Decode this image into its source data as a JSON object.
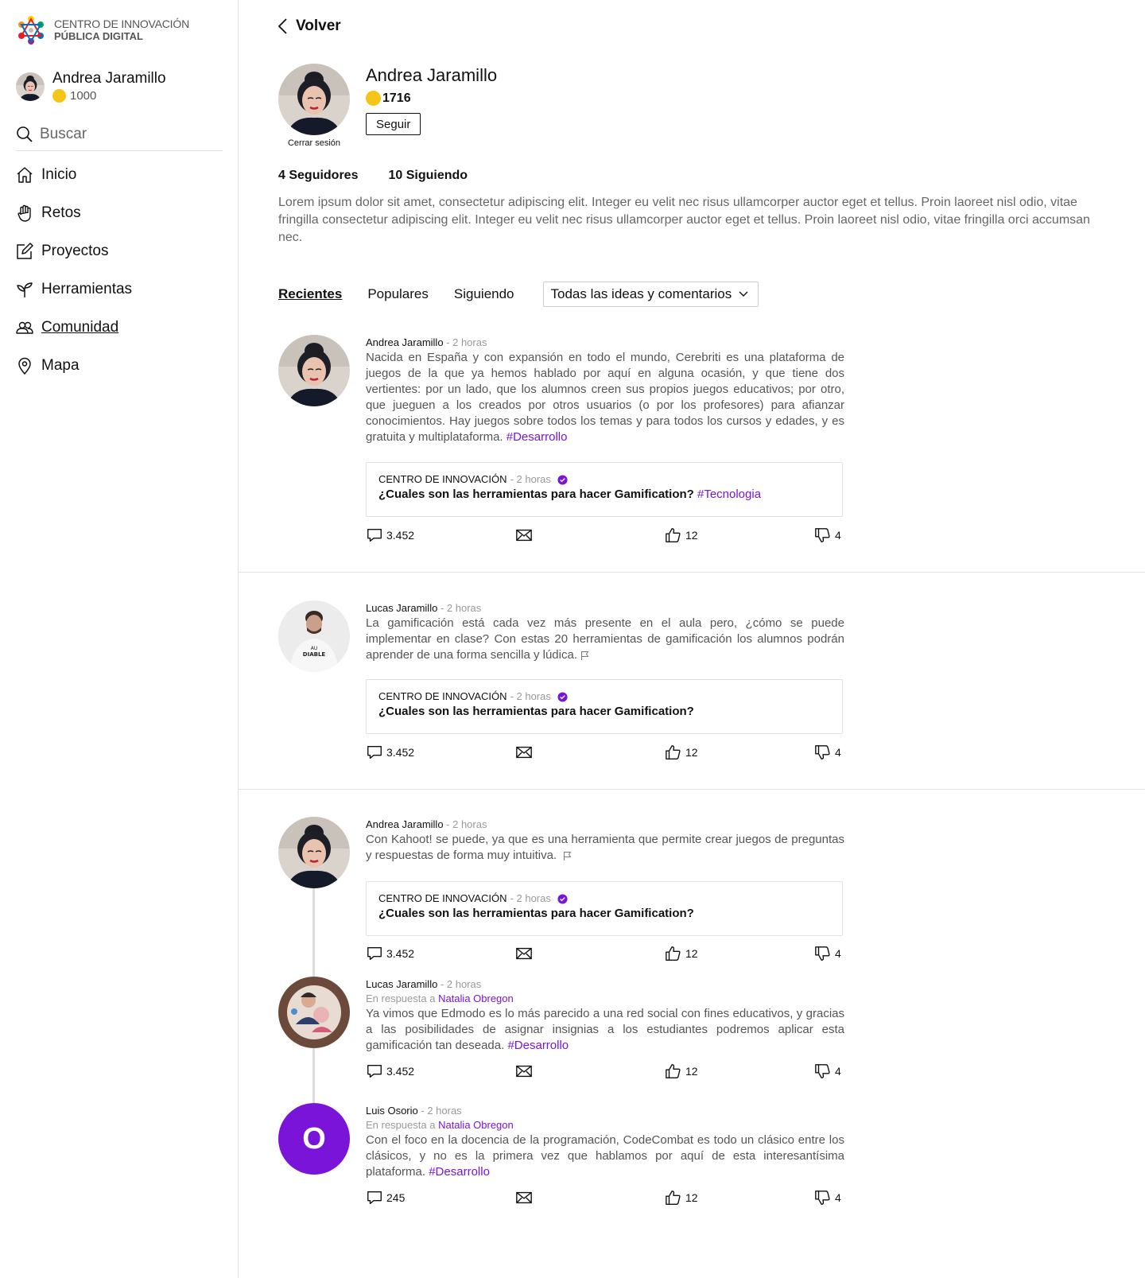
{
  "logo": {
    "line1": "CENTRO DE INNOVACIÓN",
    "line2": "PÚBLICA DIGITAL"
  },
  "sidebar_user": {
    "name": "Andrea Jaramillo",
    "coins": "1000"
  },
  "search": {
    "placeholder": "Buscar"
  },
  "nav": [
    {
      "label": "Inicio",
      "icon": "home-icon"
    },
    {
      "label": "Retos",
      "icon": "hand-icon"
    },
    {
      "label": "Proyectos",
      "icon": "edit-icon"
    },
    {
      "label": "Herramientas",
      "icon": "sprout-icon"
    },
    {
      "label": "Comunidad",
      "icon": "people-icon",
      "active": true
    },
    {
      "label": "Mapa",
      "icon": "map-pin-icon"
    }
  ],
  "back_label": "Volver",
  "profile": {
    "name": "Andrea Jaramillo",
    "coins": "1716",
    "follow_label": "Seguir",
    "logout_label": "Cerrar sesión",
    "followers": "4 Seguidores",
    "following": "10 Siguiendo",
    "bio": "Lorem ipsum dolor sit amet, consectetur adipiscing elit. Integer eu velit nec risus ullamcorper auctor eget et tellus. Proin laoreet nisl odio, vitae fringilla consectetur adipiscing elit. Integer eu velit nec risus ullamcorper auctor eget et tellus. Proin laoreet nisl odio, vitae fringilla orci accumsan nec."
  },
  "tabs": {
    "recent": "Recientes",
    "popular": "Populares",
    "following": "Siguiendo",
    "filter": "Todas las ideas y comentarios"
  },
  "colors": {
    "accent": "#7a14d8",
    "coin": "#f5c518",
    "border": "#e2e2e2"
  },
  "posts": [
    {
      "author": "Andrea Jaramillo",
      "time": "- 2 horas",
      "text": "Nacida en España y con expansión en todo el mundo, Cerebriti es una plataforma de juegos de la que ya hemos hablado por aquí en alguna ocasión, y que tiene dos vertientes: por un lado, que los alumnos creen sus propios juegos educativos; por otro, que jueguen a los creados por otros usuarios (o por los profesores) para afianzar conocimientos. Hay juegos sobre todos los temas y para todos los cursos y edades, y es gratuita y multiplataforma.",
      "tag": "#Desarrollo",
      "quote": {
        "org": "CENTRO DE INNOVACIÓN",
        "time": "- 2 horas",
        "title": "¿Cuales son las herramientas para hacer Gamification?",
        "tag": "#Tecnologia"
      },
      "comments": "3.452",
      "likes": "12",
      "dislikes": "4"
    },
    {
      "author": "Lucas Jaramillo",
      "time": "- 2 horas",
      "text": "La gamificación está cada vez más presente en el aula pero, ¿cómo se puede implementar en clase? Con estas 20 herramientas de gamificación los alumnos podrán aprender de una forma sencilla y lúdica.",
      "quote": {
        "org": "CENTRO DE INNOVACIÓN",
        "time": "- 2 horas",
        "title": "¿Cuales son las herramientas para hacer Gamification?"
      },
      "comments": "3.452",
      "likes": "12",
      "dislikes": "4"
    },
    {
      "author": "Andrea Jaramillo",
      "time": "- 2 horas",
      "text": "Con Kahoot! se puede, ya que es una herramienta que permite crear juegos de preguntas y respuestas de forma muy intuitiva.",
      "quote": {
        "org": "CENTRO DE INNOVACIÓN",
        "time": "- 2 horas",
        "title": "¿Cuales son las herramientas para hacer Gamification?"
      },
      "comments": "3.452",
      "likes": "12",
      "dislikes": "4"
    },
    {
      "author": "Lucas Jaramillo",
      "time": "- 2 horas",
      "reply_prefix": "En respuesta a",
      "reply_to": "Natalia Obregon",
      "text": "Ya vimos que Edmodo es lo más parecido a una red social con fines educativos, y gracias a las posibilidades de asignar insignias a los estudiantes podremos aplicar esta gamificación tan deseada.",
      "tag": "#Desarrollo",
      "comments": "3.452",
      "likes": "12",
      "dislikes": "4"
    },
    {
      "author": "Luis Osorio",
      "time": "- 2 horas",
      "initial": "O",
      "reply_prefix": "En respuesta a",
      "reply_to": "Natalia Obregon",
      "text": "Con el foco en la docencia de la programación, CodeCombat es todo un clásico entre los clásicos, y no es la primera vez que hablamos por aquí de esta interesantísima plataforma.",
      "tag": "#Desarrollo",
      "comments": "245",
      "likes": "12",
      "dislikes": "4"
    }
  ]
}
